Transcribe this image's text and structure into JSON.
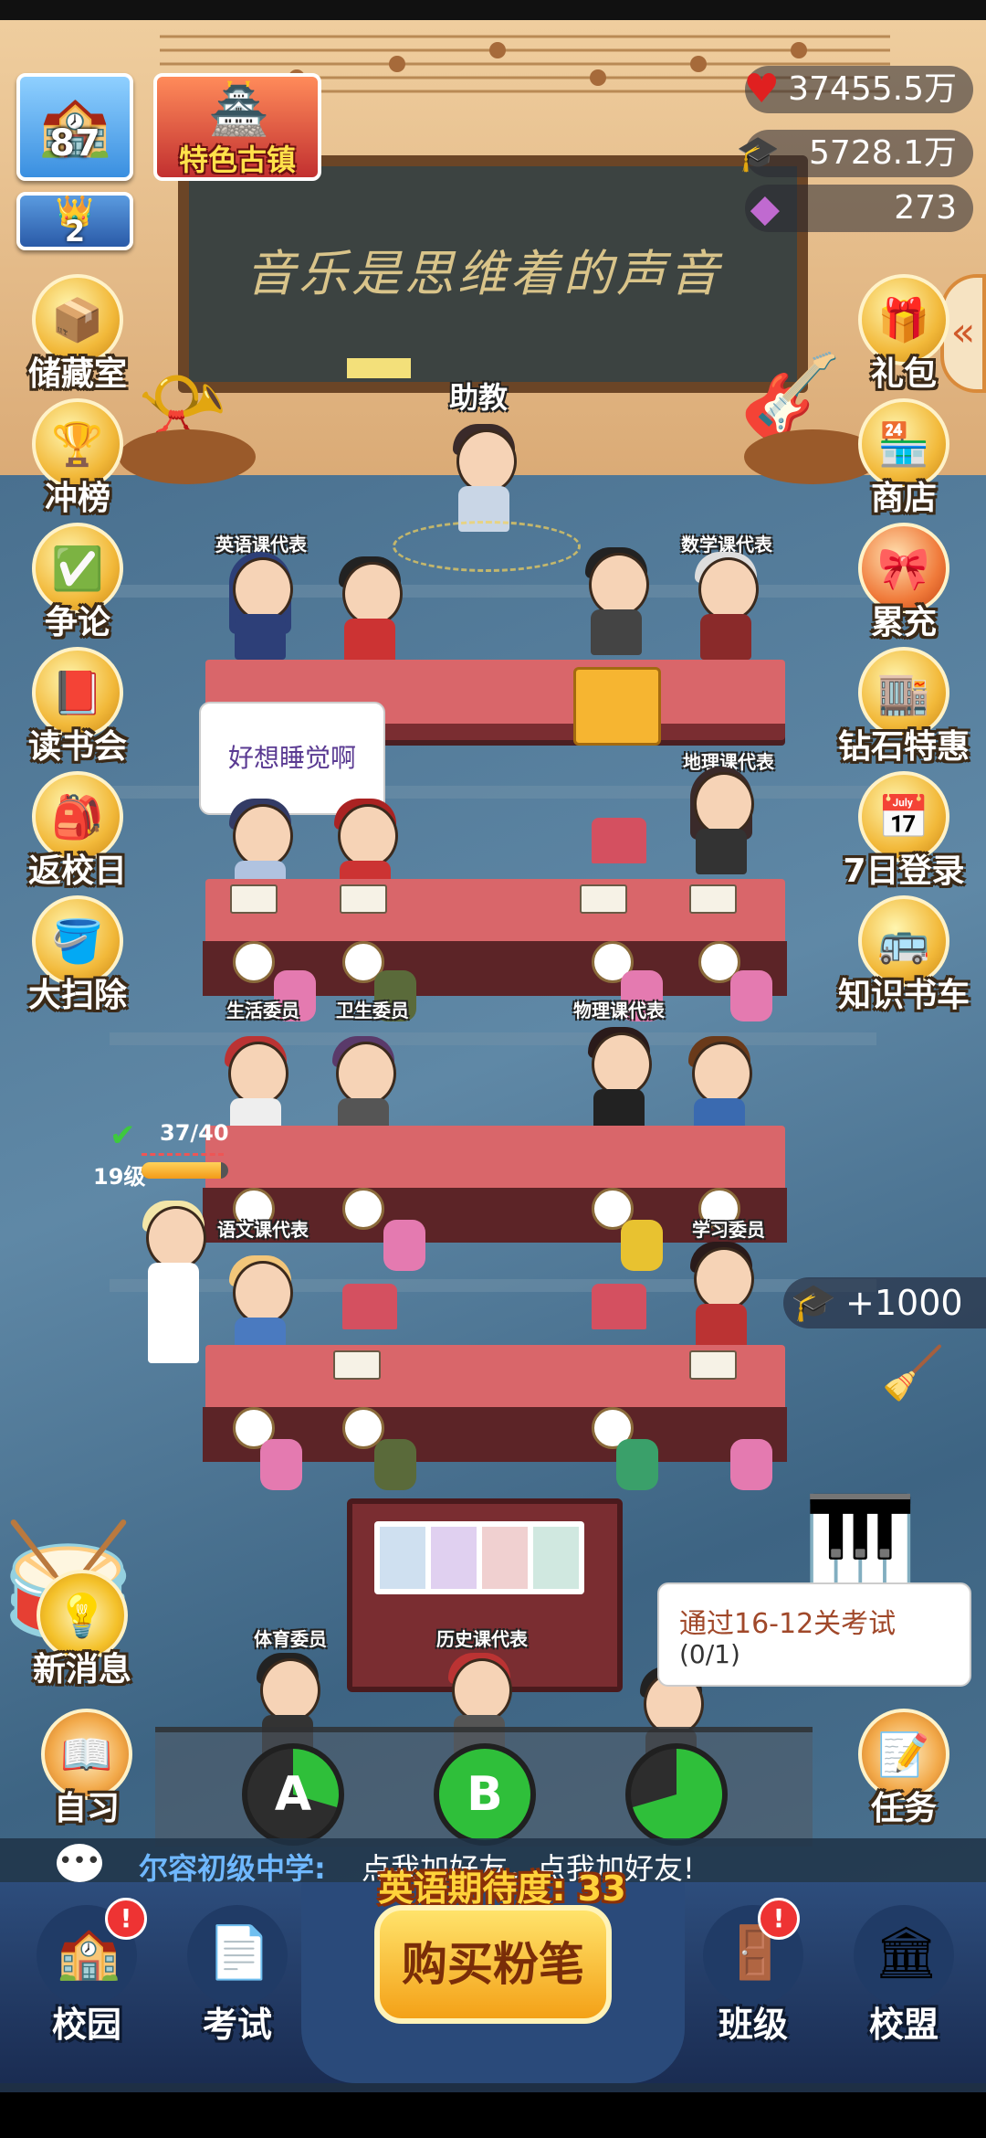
{
  "resources": {
    "hearts": "37455.5万",
    "caps": "5728.1万",
    "gems": "273"
  },
  "school": {
    "level": "87",
    "rank": "2",
    "town_label": "特色古镇"
  },
  "board_text": "音乐是思维着的声音",
  "assistant_label": "助教",
  "left_menu": [
    "储藏室",
    "冲榜",
    "争论",
    "读书会",
    "返校日",
    "大扫除"
  ],
  "right_menu": [
    "礼包",
    "商店",
    "累充",
    "钻石特惠",
    "7日登录",
    "知识书车"
  ],
  "roles": {
    "english": "英语课代表",
    "math": "数学课代表",
    "geography": "地理课代表",
    "life": "生活委员",
    "health": "卫生委员",
    "physics": "物理课代表",
    "chinese": "语文课代表",
    "study": "学习委员",
    "sports": "体育委员",
    "history": "历史课代表"
  },
  "speech_bubble": "好想睡觉啊",
  "student_progress": {
    "count": "37/40",
    "level": "19级",
    "fraction": 0.92
  },
  "reward_popup": "+1000",
  "task_bubble": {
    "line1": "通过16-12关考试",
    "line2": "(0/1)"
  },
  "news_label": "新消息",
  "self_study_label": "自习",
  "task_label": "任务",
  "ab_buttons": [
    "A",
    "B",
    ""
  ],
  "chat": {
    "sender": "尔容初级中学:",
    "message": "点我加好友，点我加好友!"
  },
  "expectation": "英语期待度: 33",
  "buy_button": "购买粉笔",
  "bottom_nav": [
    "校园",
    "考试",
    "班级",
    "校盟"
  ]
}
